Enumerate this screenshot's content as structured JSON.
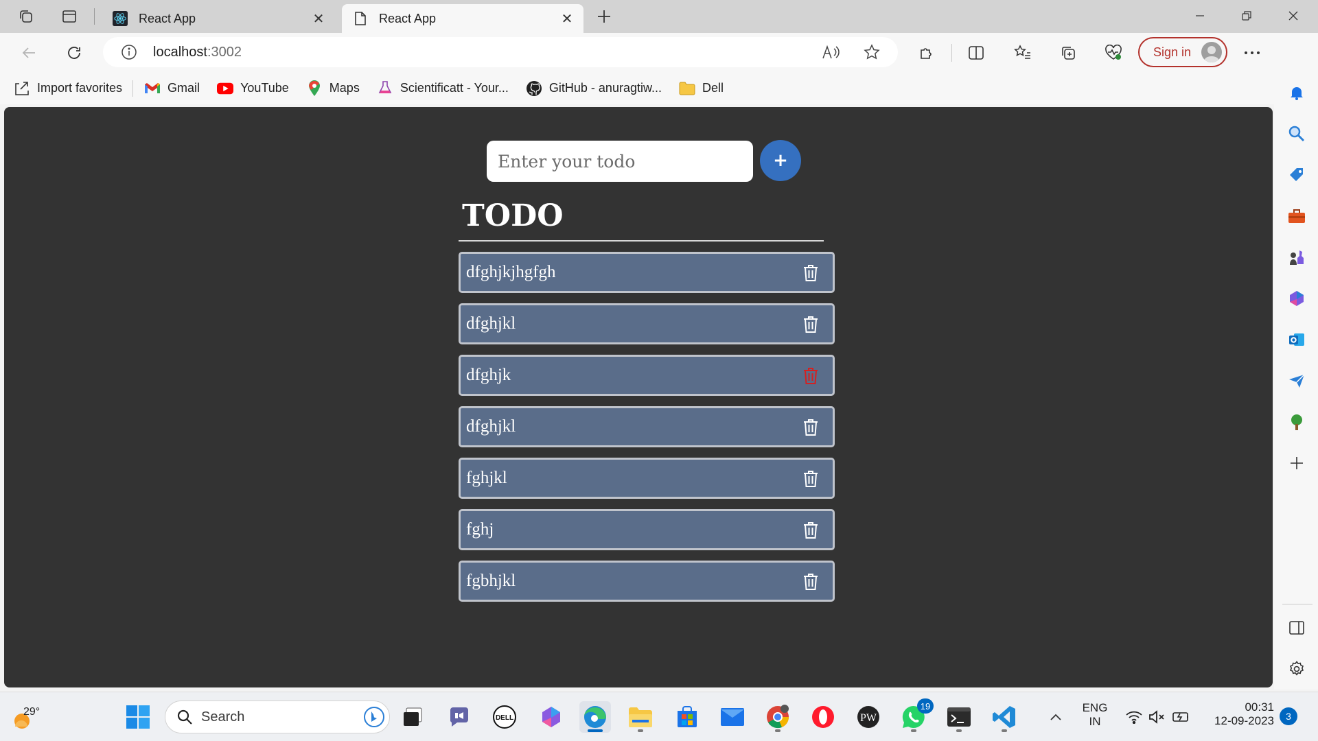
{
  "browser": {
    "tabs": [
      {
        "title": "React App",
        "active": false
      },
      {
        "title": "React App",
        "active": true
      }
    ],
    "address": {
      "host": "localhost",
      "port": ":3002"
    },
    "signin_label": "Sign in",
    "favorites": [
      {
        "label": "Import favorites",
        "icon": "import-icon"
      },
      {
        "label": "Gmail",
        "icon": "gmail-icon"
      },
      {
        "label": "YouTube",
        "icon": "youtube-icon"
      },
      {
        "label": "Maps",
        "icon": "maps-pin-icon"
      },
      {
        "label": "Scientificatt - Your...",
        "icon": "scientificatt-icon"
      },
      {
        "label": "GitHub - anuragtiw...",
        "icon": "github-icon"
      },
      {
        "label": "Dell",
        "icon": "folder-icon"
      }
    ]
  },
  "app": {
    "input_placeholder": "Enter your todo",
    "add_label": "+",
    "heading": "TODO",
    "todos": [
      {
        "text": "dfghjkjhgfgh",
        "delete_hovered": false
      },
      {
        "text": "dfghjkl",
        "delete_hovered": false
      },
      {
        "text": "dfghjk",
        "delete_hovered": true
      },
      {
        "text": "dfghjkl",
        "delete_hovered": false
      },
      {
        "text": "fghjkl",
        "delete_hovered": false
      },
      {
        "text": "fghj",
        "delete_hovered": false
      },
      {
        "text": "fgbhjkl",
        "delete_hovered": false
      }
    ],
    "colors": {
      "background": "#333333",
      "item": "#5a6d8a",
      "add_button": "#3570c0",
      "trash_hover": "#d62020"
    }
  },
  "taskbar": {
    "weather_temp": "29°",
    "search_label": "Search",
    "whatsapp_badge": "19",
    "language": {
      "line1": "ENG",
      "line2": "IN"
    },
    "time": "00:31",
    "date": "12-09-2023",
    "notification_count": "3"
  }
}
